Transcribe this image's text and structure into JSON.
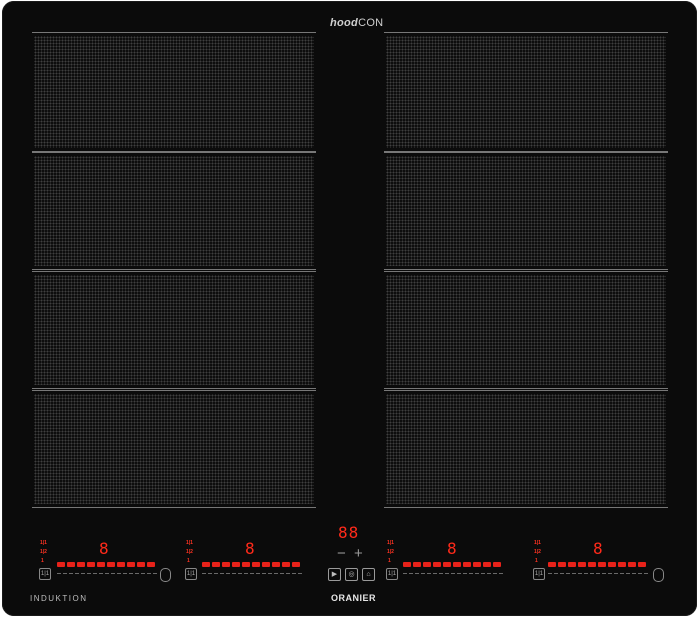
{
  "top_logo": {
    "bold": "hood",
    "rest": "CON"
  },
  "timer_display": "88",
  "timer_minus": "−",
  "timer_plus": "+",
  "zone_displays": [
    "8",
    "8",
    "8",
    "8"
  ],
  "level_marks": [
    "1|1",
    "1|2",
    "1"
  ],
  "boost_label": "1|1",
  "center_buttons": {
    "play": "▶",
    "pause": "◎",
    "hood": "⌂"
  },
  "footer_left": "INDUKTION",
  "footer_brand": "ORANIER",
  "colors": {
    "glass": "#0b0b0b",
    "led": "#e8221a",
    "text": "#cfcfcf"
  }
}
